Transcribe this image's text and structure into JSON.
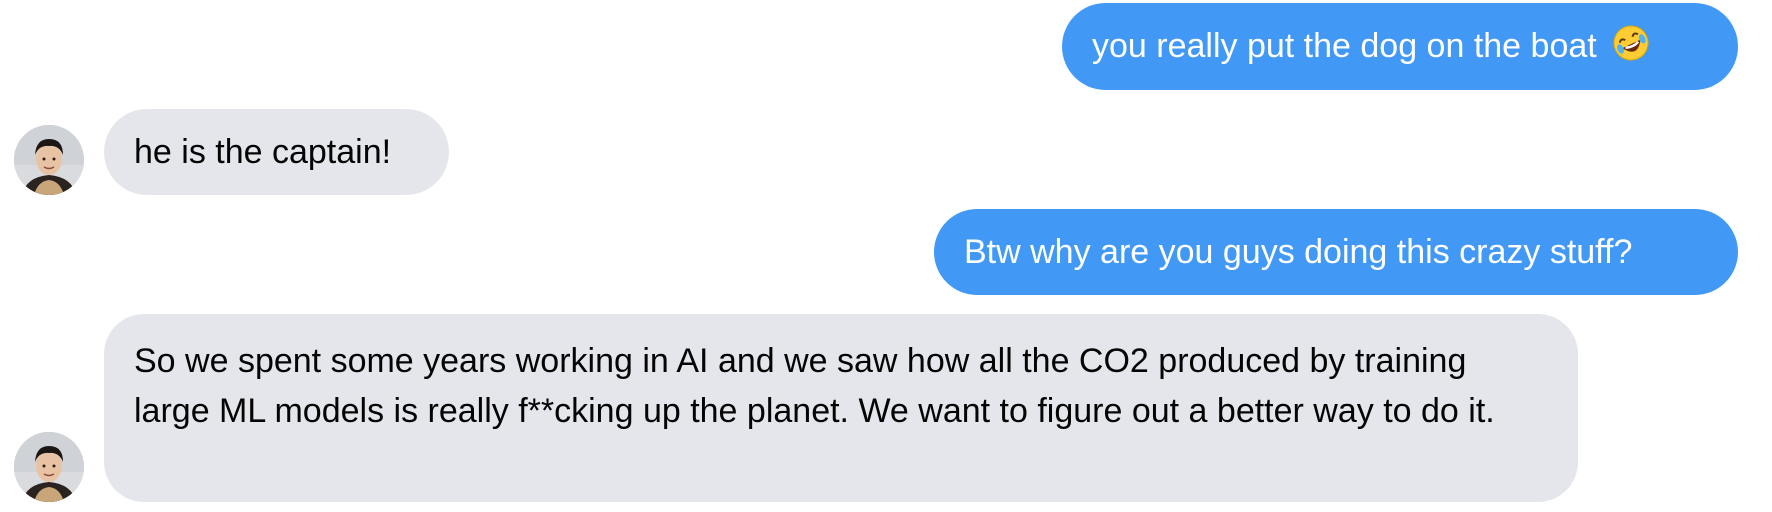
{
  "conversation": {
    "messages": [
      {
        "direction": "sent",
        "text": "you really put the dog on the boat",
        "emoji": "rolling-on-floor-laughing-emoji"
      },
      {
        "direction": "received",
        "text": "he is the captain!"
      },
      {
        "direction": "sent",
        "text": "Btw why are you guys doing this crazy stuff?"
      },
      {
        "direction": "received",
        "text": "So we spent some years working in AI and we saw how all the CO2 produced by training large ML models is really f**cking up the planet. We want to figure out a better way to do it."
      }
    ]
  },
  "colors": {
    "sent_bubble": "#4299f5",
    "received_bubble": "#e4e6eb",
    "sent_text": "#ffffff",
    "received_text": "#050505"
  }
}
